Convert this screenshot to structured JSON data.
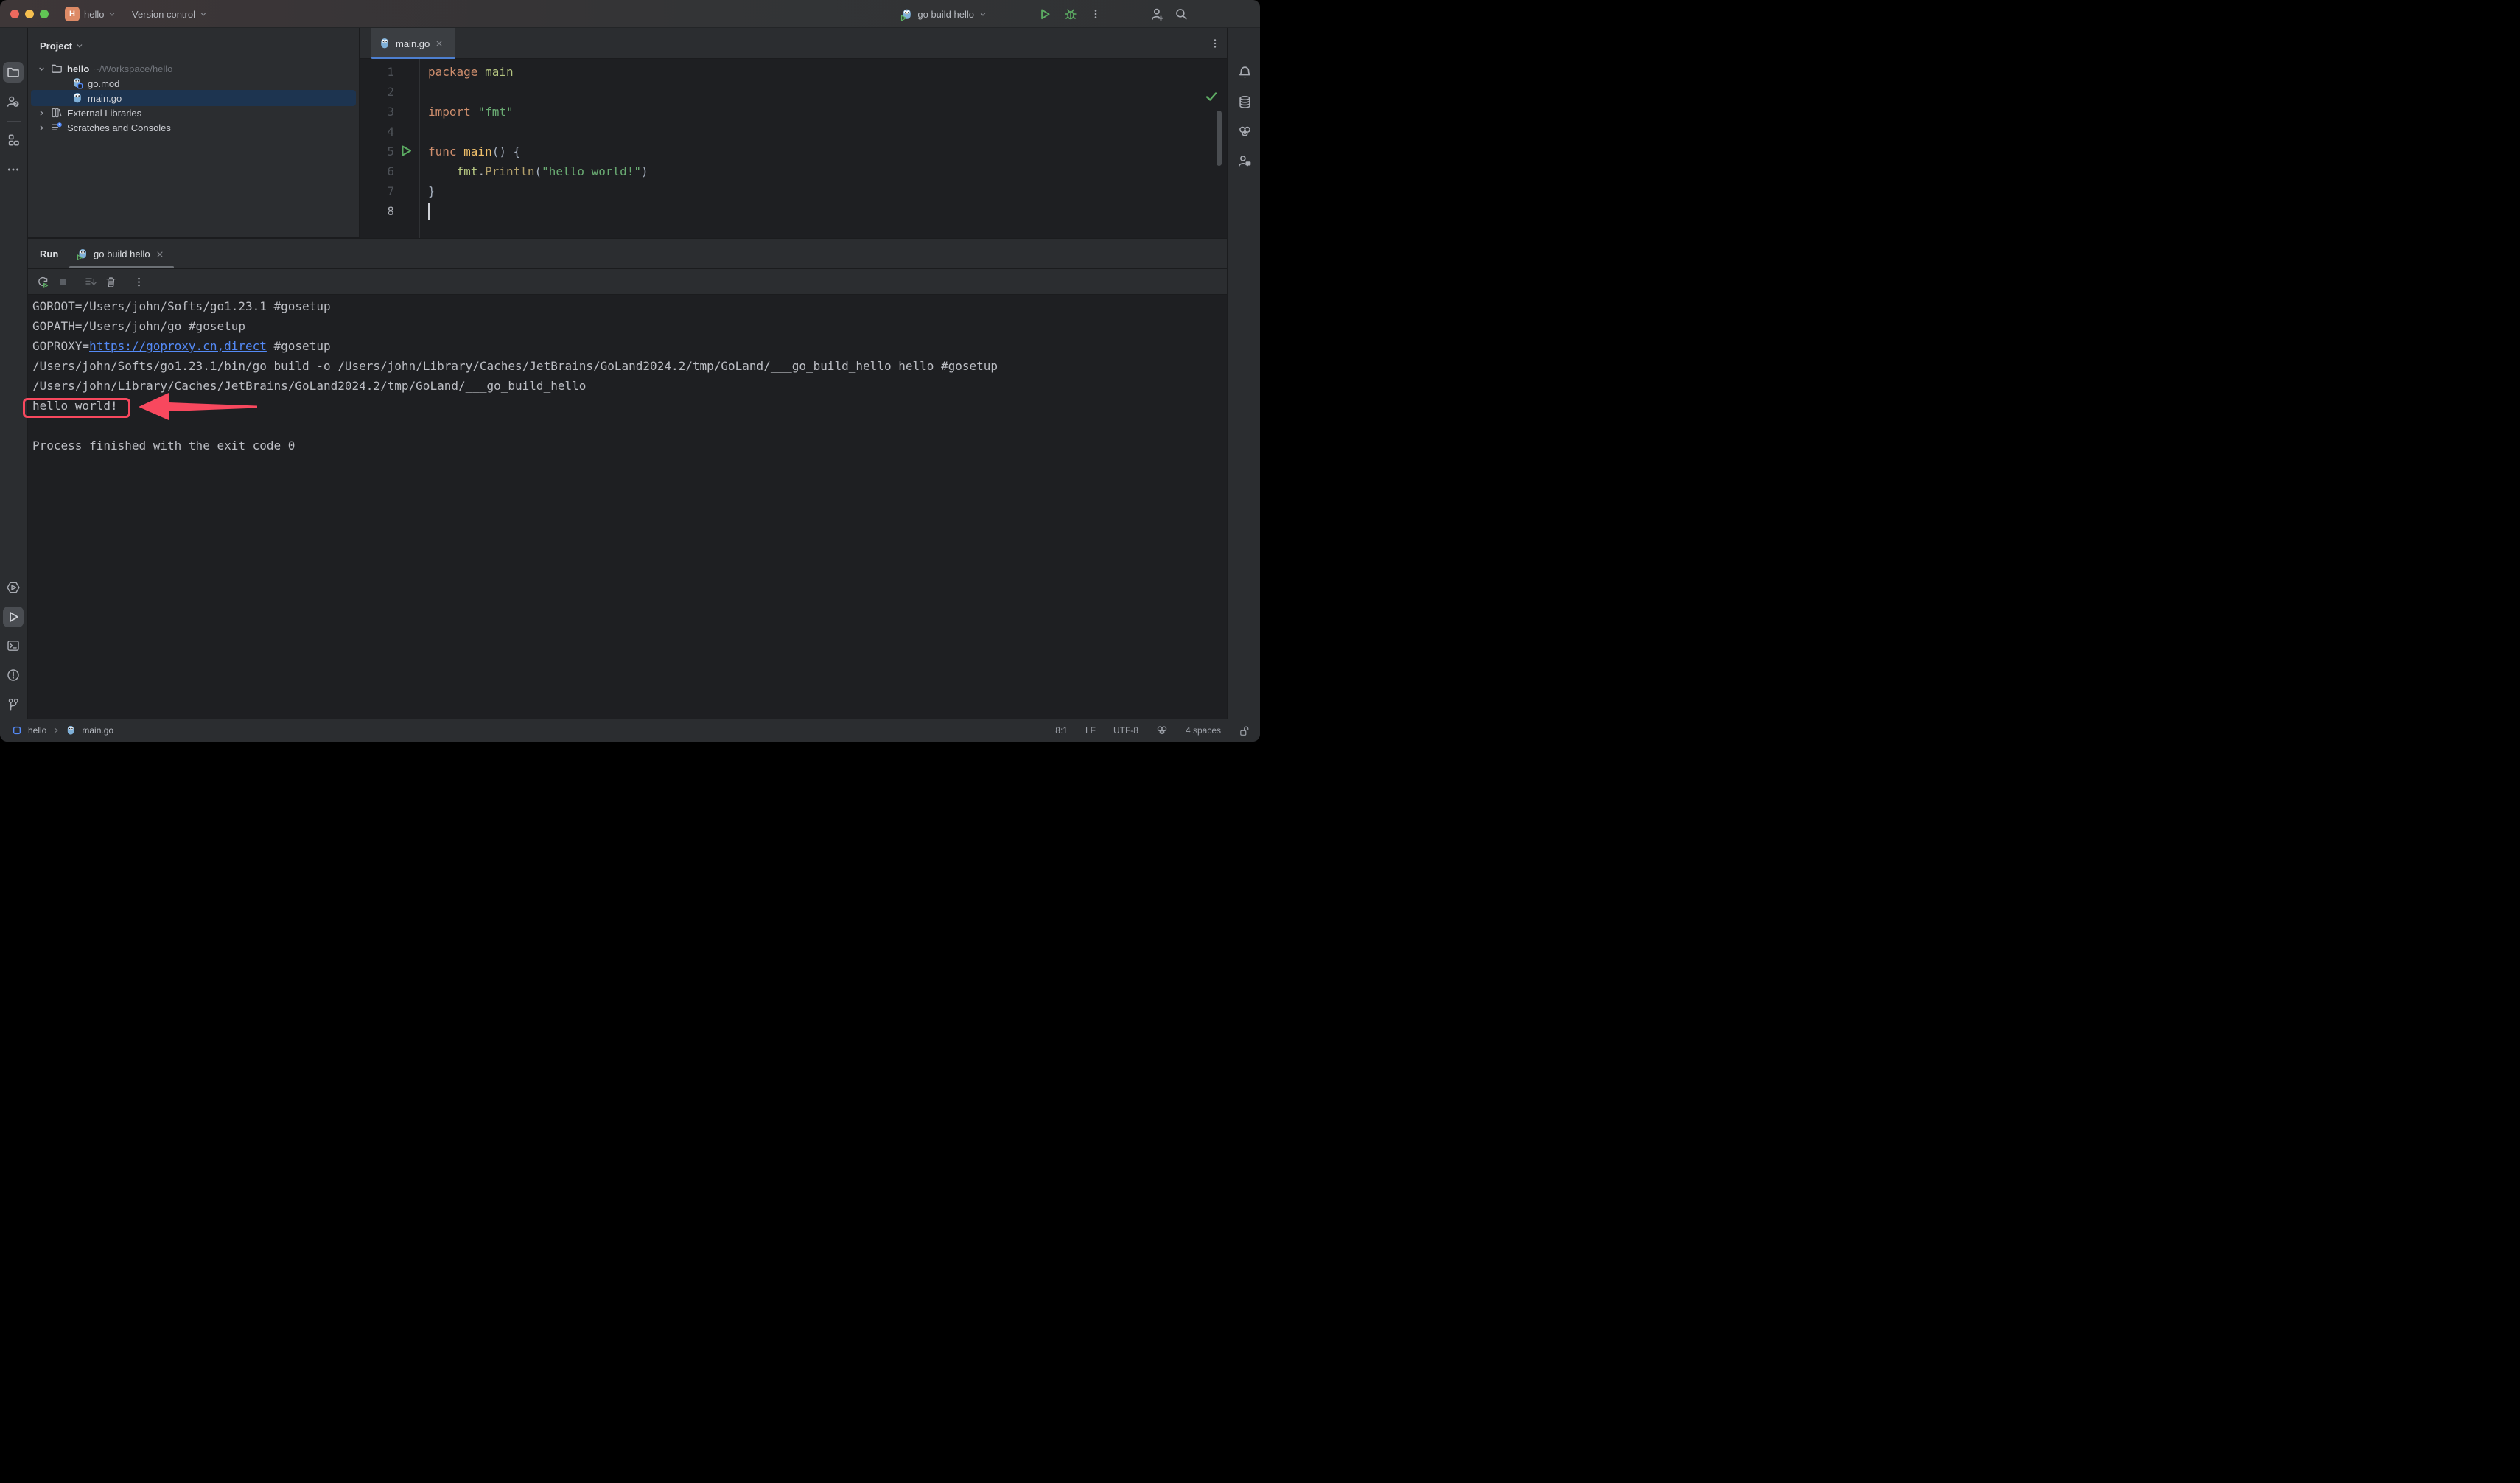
{
  "colors": {
    "annotation": "#f8485e",
    "link": "#548af7",
    "tab-underline": "#4d7fd0",
    "run-green": "#5cad63",
    "keyword": "#cf8e6d",
    "string": "#6aab73",
    "func-decl": "#efbf6a",
    "package-name": "#b5c581",
    "func-call": "#b3a06b",
    "selection": "#1d3450",
    "gear-badge": "#f2c55c",
    "avatar-bg": "#dd8a66"
  },
  "titlebar": {
    "avatar_letter": "H",
    "project_button": "hello",
    "vcs_button": "Version control",
    "run_config": "go build hello"
  },
  "left_stripe": {
    "top_icons": [
      "project-folder",
      "person-question",
      "structure",
      "more"
    ],
    "bottom_icons": [
      "services",
      "run",
      "terminal",
      "problems",
      "git-branch"
    ]
  },
  "right_stripe": {
    "icons": [
      "notifications",
      "database",
      "gopher",
      "code-with-me"
    ]
  },
  "project_panel": {
    "header": "Project",
    "root_name": "hello",
    "root_path": "~/Workspace/hello",
    "file_gomod": "go.mod",
    "file_maingo": "main.go",
    "node_external": "External Libraries",
    "node_scratches": "Scratches and Consoles"
  },
  "editor": {
    "tab": "main.go",
    "gutter": [
      "1",
      "2",
      "3",
      "4",
      "5",
      "6",
      "7",
      "8"
    ],
    "code": {
      "l1": {
        "kw": "package",
        "name": " main"
      },
      "l3": {
        "kw": "import",
        "str": " \"fmt\""
      },
      "l5": {
        "kw": "func",
        "name": " main",
        "punc": "() ",
        "brace": "{"
      },
      "l6": {
        "indent": "    ",
        "pkg": "fmt",
        "dot": ".",
        "call": "Println",
        "open": "(",
        "str": "\"hello world!\"",
        "close": ")"
      },
      "l7": {
        "brace": "}"
      }
    }
  },
  "run_panel": {
    "title": "Run",
    "tab": "go build hello",
    "console": {
      "line1": "GOROOT=/Users/john/Softs/go1.23.1 #gosetup",
      "line2": "GOPATH=/Users/john/go #gosetup",
      "line3_prefix": "GOPROXY=",
      "line3_link": "https://goproxy.cn,direct",
      "line3_suffix": " #gosetup",
      "line4": "/Users/john/Softs/go1.23.1/bin/go build -o /Users/john/Library/Caches/JetBrains/GoLand2024.2/tmp/GoLand/___go_build_hello hello #gosetup",
      "line5": "/Users/john/Library/Caches/JetBrains/GoLand2024.2/tmp/GoLand/___go_build_hello",
      "line6": "hello world!",
      "line8": "Process finished with the exit code 0"
    }
  },
  "status_bar": {
    "breadcrumb_project": "hello",
    "breadcrumb_file": "main.go",
    "caret": "8:1",
    "line_ending": "LF",
    "encoding": "UTF-8",
    "indent": "4 spaces"
  }
}
